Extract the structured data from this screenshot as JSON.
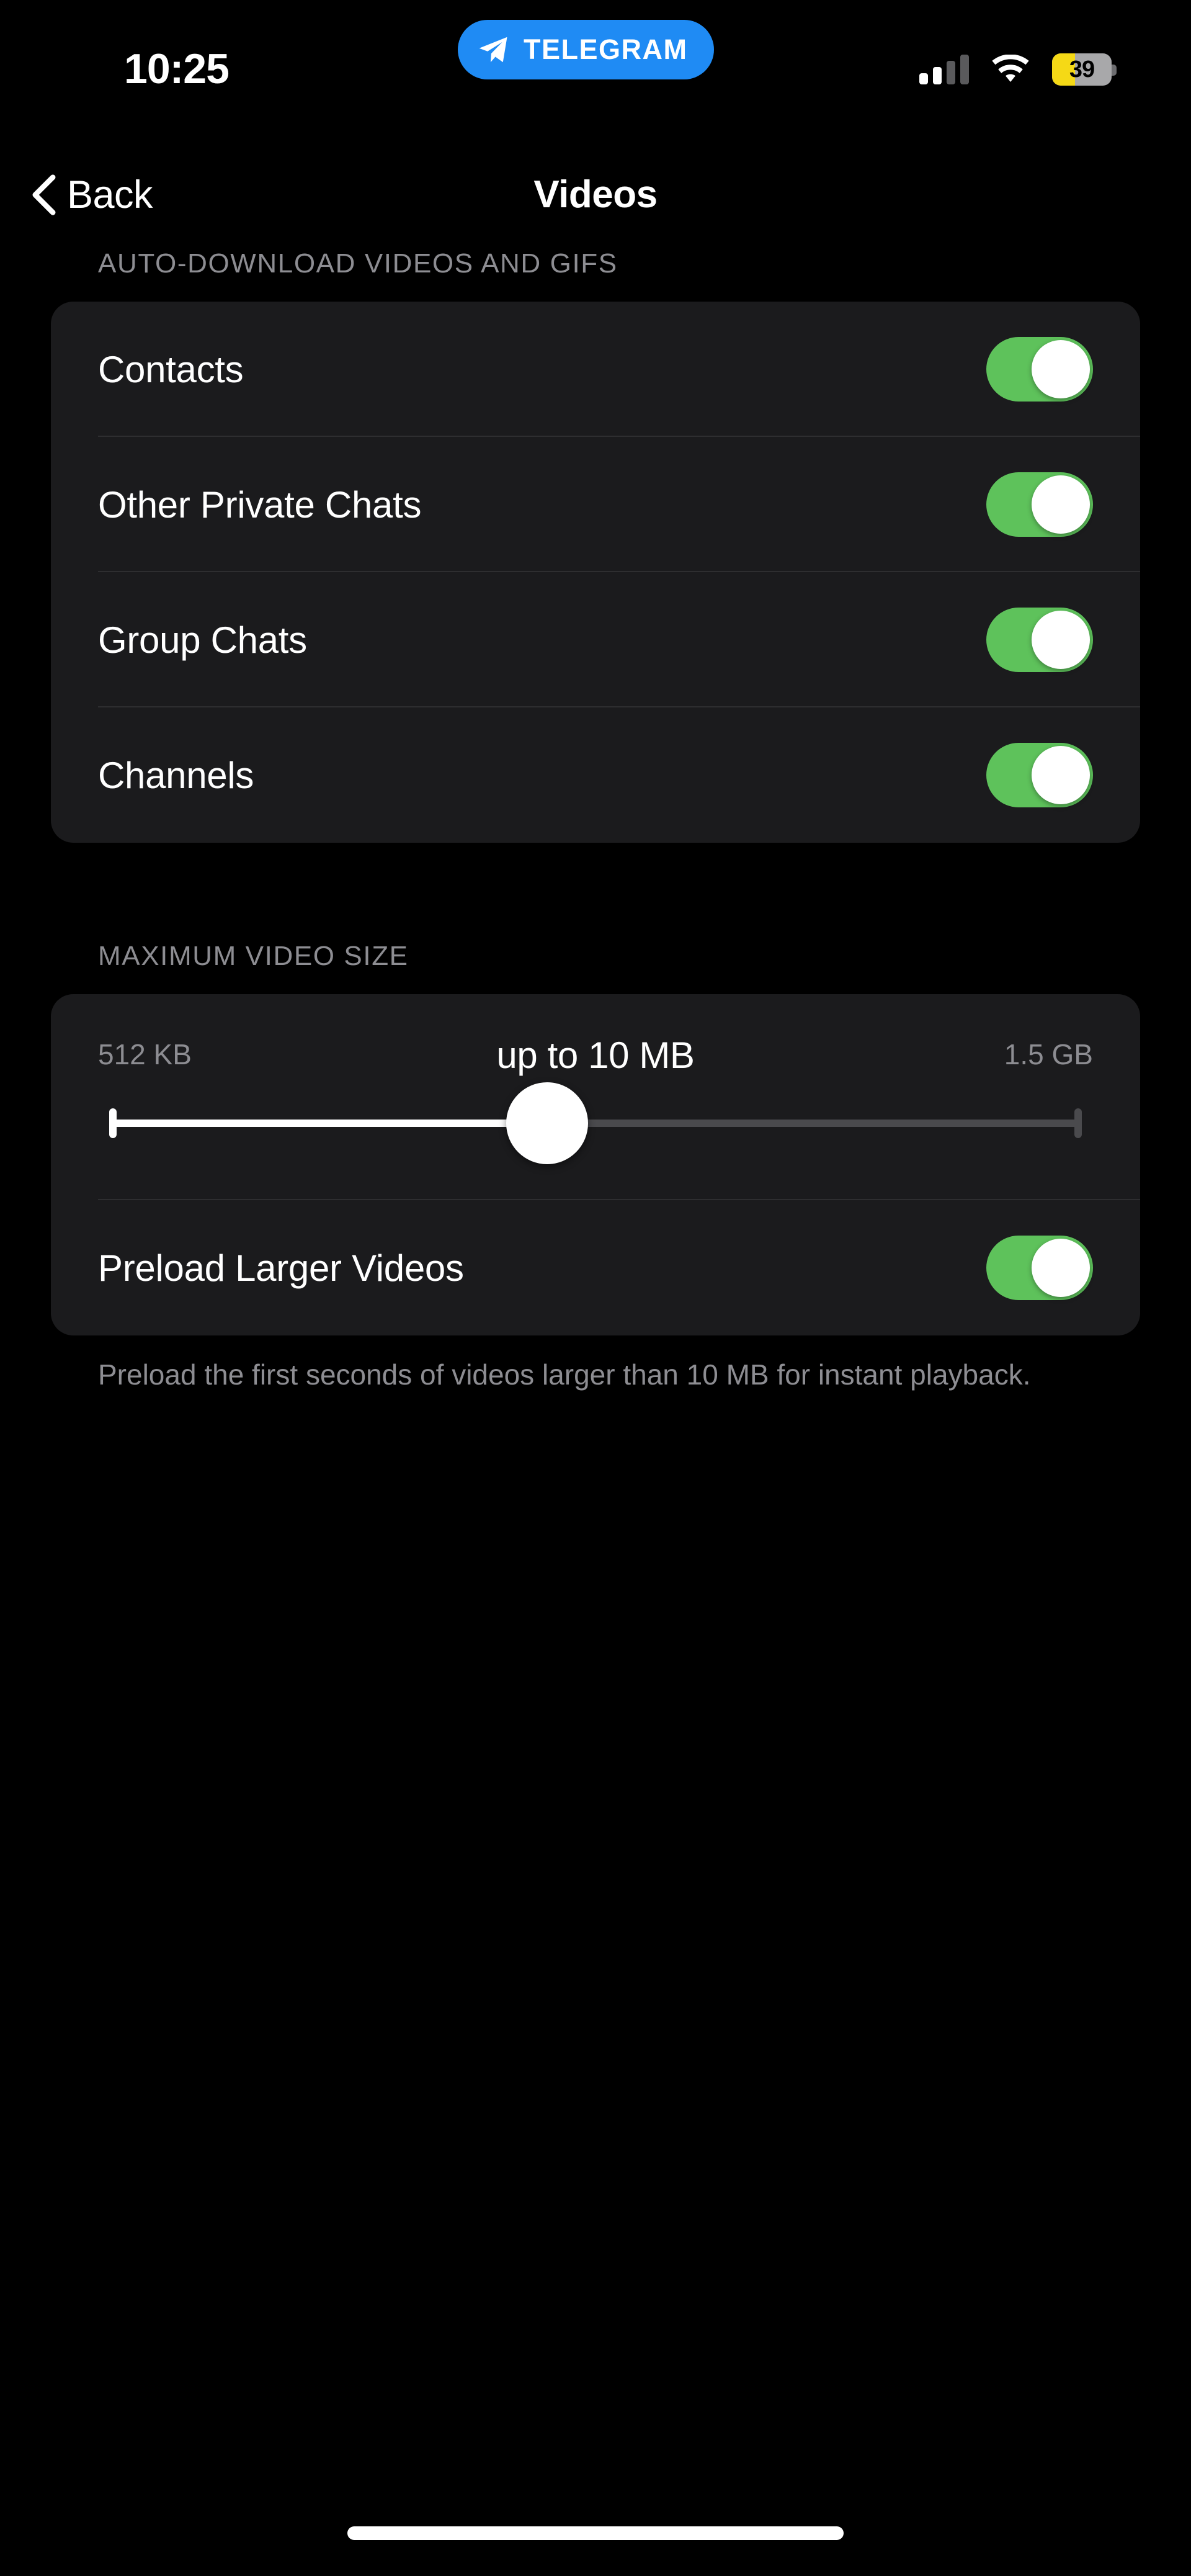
{
  "status_bar": {
    "time": "10:25",
    "app_pill": {
      "label": "TELEGRAM",
      "icon": "paper-plane-icon",
      "color": "#1f8bf4"
    },
    "signal_icon": "cellular-signal-icon",
    "signal_bars_filled": 2,
    "signal_bars_total": 4,
    "wifi_icon": "wifi-icon",
    "battery": {
      "percent": "39",
      "fill_color": "#f5d916",
      "body_color": "#a8a8aa"
    }
  },
  "navbar": {
    "back_icon": "chevron-left-icon",
    "back_label": "Back",
    "title": "Videos"
  },
  "sections": [
    {
      "header": "AUTO-DOWNLOAD VIDEOS AND GIFS",
      "rows": [
        {
          "label": "Contacts",
          "toggle": "on"
        },
        {
          "label": "Other Private Chats",
          "toggle": "on"
        },
        {
          "label": "Group Chats",
          "toggle": "on"
        },
        {
          "label": "Channels",
          "toggle": "on"
        }
      ]
    },
    {
      "header": "MAXIMUM VIDEO SIZE",
      "slider": {
        "min_label": "512 KB",
        "max_label": "1.5 GB",
        "current_label": "up to 10 MB",
        "percent": 45
      },
      "rows": [
        {
          "label": "Preload Larger Videos",
          "toggle": "on"
        }
      ],
      "footnote": "Preload the first seconds of videos larger than 10 MB for instant playback."
    }
  ],
  "colors": {
    "background": "#000000",
    "card": "#1b1b1d",
    "toggle_on": "#5ec25b",
    "secondary_text": "#8d8d92",
    "accent_blue": "#1f8bf4"
  },
  "home_indicator": "home-indicator"
}
